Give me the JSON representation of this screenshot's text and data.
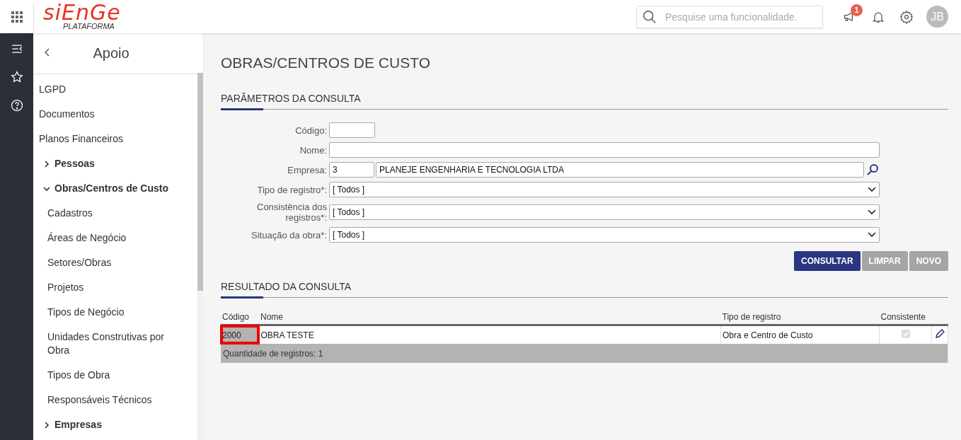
{
  "header": {
    "logo": "siEnGe",
    "logo_sub": "PLATAFORMA",
    "search": {
      "placeholder": "Pesquise uma funcionalidade."
    },
    "badge": "1",
    "avatar": "JB"
  },
  "sidebar": {
    "title": "Apoio",
    "items": [
      {
        "kind": "link",
        "label": "LGPD"
      },
      {
        "kind": "link",
        "label": "Documentos"
      },
      {
        "kind": "link",
        "label": "Planos Financeiros"
      },
      {
        "kind": "group",
        "label": "Pessoas",
        "expanded": false
      },
      {
        "kind": "group",
        "label": "Obras/Centros de Custo",
        "expanded": true,
        "children": [
          {
            "label": "Cadastros"
          },
          {
            "label": "Áreas de Negócio"
          },
          {
            "label": "Setores/Obras"
          },
          {
            "label": "Projetos"
          },
          {
            "label": "Tipos de Negócio"
          },
          {
            "label": "Unidades Construtivas por Obra"
          },
          {
            "label": "Tipos de Obra"
          },
          {
            "label": "Responsáveis Técnicos"
          }
        ]
      },
      {
        "kind": "group",
        "label": "Empresas",
        "expanded": false
      }
    ]
  },
  "page_title": "OBRAS/CENTROS DE CUSTO",
  "params": {
    "title": "PARÂMETROS DA CONSULTA",
    "fields": [
      {
        "kind": "short",
        "label": "Código:"
      },
      {
        "kind": "text",
        "label": "Nome:"
      },
      {
        "kind": "lookup",
        "label": "Empresa:",
        "code": "3",
        "value": "PLANEJE ENGENHARIA E TECNOLOGIA LTDA"
      },
      {
        "kind": "select",
        "label": "Tipo de registro*:",
        "value": "[ Todos ]"
      },
      {
        "kind": "select",
        "label": "Consistência dos registros*:",
        "value": "[ Todos ]"
      },
      {
        "kind": "select",
        "label": "Situação da obra*:",
        "value": "[ Todos ]"
      }
    ]
  },
  "buttons": [
    {
      "label": "CONSULTAR",
      "disabled": false
    },
    {
      "label": "LIMPAR",
      "disabled": true
    },
    {
      "label": "NOVO",
      "disabled": true
    }
  ],
  "results": {
    "title": "RESULTADO DA CONSULTA",
    "columns": [
      "Código",
      "Nome",
      "Tipo de registro",
      "Consistente"
    ],
    "rows": [
      {
        "code": "2000",
        "name": "OBRA TESTE",
        "type": "Obra e Centro de Custo",
        "consistent": true,
        "highlighted": true
      }
    ],
    "footer": "Quantidade de registros: 1"
  }
}
